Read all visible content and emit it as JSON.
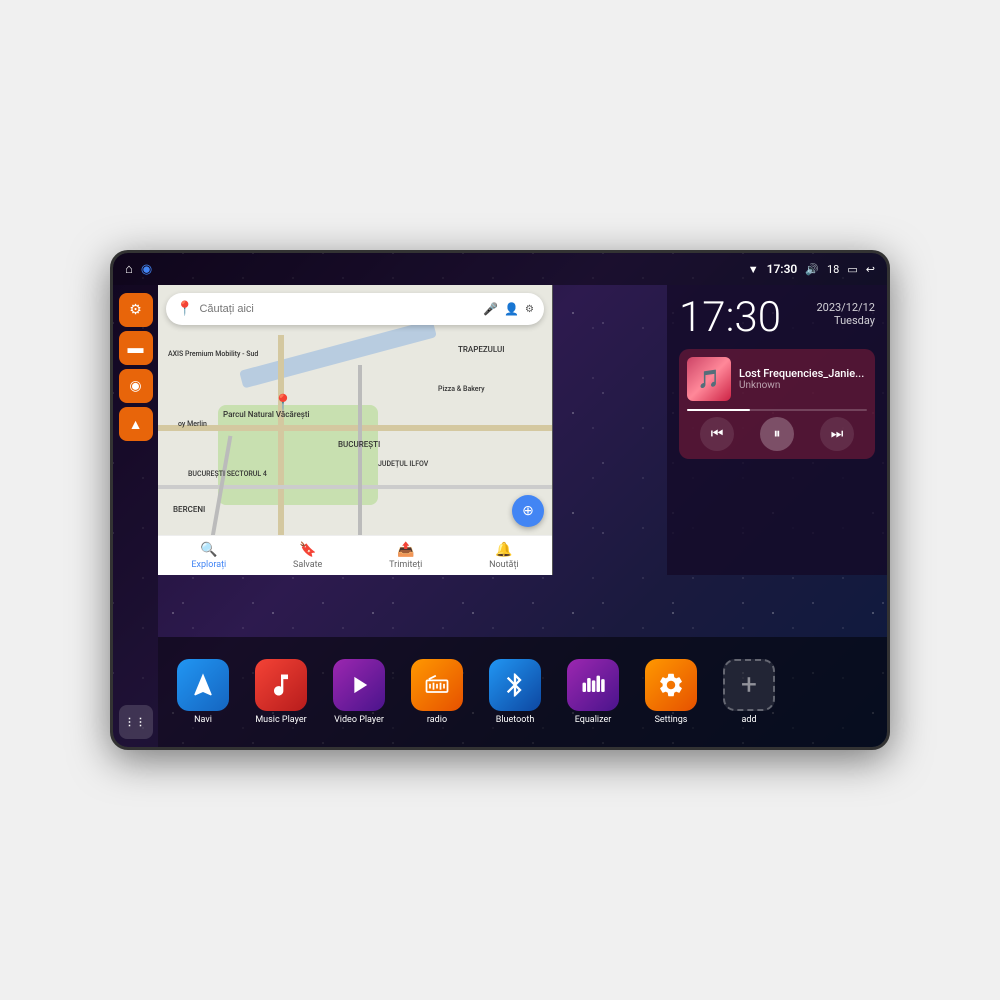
{
  "status_bar": {
    "time": "17:30",
    "battery": "18",
    "icons": [
      "wifi",
      "volume",
      "battery",
      "back"
    ]
  },
  "sidebar": {
    "buttons": [
      {
        "id": "settings",
        "icon": "⚙",
        "label": "Settings"
      },
      {
        "id": "files",
        "icon": "▬",
        "label": "Files"
      },
      {
        "id": "location",
        "icon": "◉",
        "label": "Location"
      },
      {
        "id": "navigation",
        "icon": "▲",
        "label": "Navigation"
      },
      {
        "id": "apps",
        "icon": "⋮⋮",
        "label": "Apps"
      }
    ]
  },
  "map": {
    "search_placeholder": "Căutați aici",
    "bottom_nav": [
      {
        "label": "Explorați",
        "active": true
      },
      {
        "label": "Salvate",
        "active": false
      },
      {
        "label": "Trimiteți",
        "active": false
      },
      {
        "label": "Noutăți",
        "active": false
      }
    ],
    "labels": [
      "Parcul Natural Văcărești",
      "BUCUREȘTI",
      "BUCUREȘTI SECTORUL 4",
      "BERCENI",
      "JUDEȚUL ILFOV",
      "TRAPEZULUI",
      "Pizza & Bakery",
      "AXIS Premium Mobility - Sud",
      "oy Merlin"
    ]
  },
  "clock": {
    "time": "17:30",
    "date": "2023/12/12",
    "day": "Tuesday"
  },
  "music": {
    "title": "Lost Frequencies_Janie...",
    "artist": "Unknown",
    "progress": 35
  },
  "apps": [
    {
      "id": "navi",
      "label": "Navi",
      "icon": "▲",
      "class": "icon-navi"
    },
    {
      "id": "music-player",
      "label": "Music Player",
      "icon": "♪",
      "class": "icon-music"
    },
    {
      "id": "video-player",
      "label": "Video Player",
      "icon": "▶",
      "class": "icon-video"
    },
    {
      "id": "radio",
      "label": "radio",
      "icon": "≋",
      "class": "icon-radio"
    },
    {
      "id": "bluetooth",
      "label": "Bluetooth",
      "icon": "⚡",
      "class": "icon-bluetooth"
    },
    {
      "id": "equalizer",
      "label": "Equalizer",
      "icon": "▐▌",
      "class": "icon-equalizer"
    },
    {
      "id": "settings",
      "label": "Settings",
      "icon": "⚙",
      "class": "icon-settings"
    },
    {
      "id": "add",
      "label": "add",
      "icon": "+",
      "class": "icon-add"
    }
  ]
}
